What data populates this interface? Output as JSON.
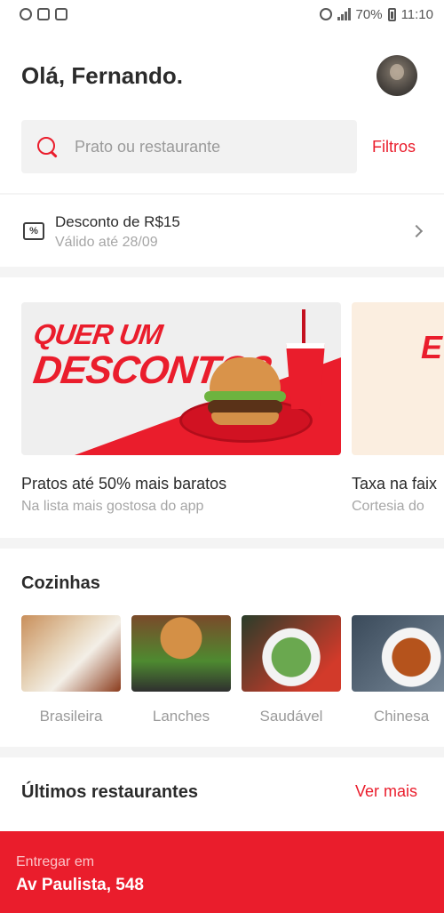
{
  "status_bar": {
    "battery": "70%",
    "time": "11:10",
    "left_icons": [
      "whatsapp-icon",
      "instagram-icon",
      "gallery-icon"
    ],
    "right_icons": [
      "mute-icon",
      "alarm-icon",
      "volte-icon",
      "wifi-icon",
      "nfc-icon",
      "signal-icon",
      "battery-icon"
    ]
  },
  "header": {
    "greeting": "Olá, Fernando.",
    "avatar_icon": "user-avatar"
  },
  "search": {
    "placeholder": "Prato ou restaurante",
    "filters_label": "Filtros",
    "icon": "search-icon"
  },
  "coupon": {
    "title": "Desconto de R$15",
    "subtitle": "Válido até 28/09",
    "icon_glyph": "%"
  },
  "banners": [
    {
      "headline_line1": "QUER UM",
      "headline_line2": "DESCONTO?",
      "title": "Pratos até 50% mais baratos",
      "subtitle": "Na lista mais gostosa do app"
    },
    {
      "headline_line1": "E",
      "title": "Taxa na faix",
      "subtitle": "Cortesia do"
    }
  ],
  "cuisines": {
    "title": "Cozinhas",
    "items": [
      {
        "label": "Brasileira"
      },
      {
        "label": "Lanches"
      },
      {
        "label": "Saudável"
      },
      {
        "label": "Chinesa"
      }
    ]
  },
  "recent": {
    "title": "Últimos restaurantes",
    "see_more_label": "Ver mais"
  },
  "delivery": {
    "label": "Entregar em",
    "address": "Av Paulista, 548"
  },
  "colors": {
    "brand_red": "#ea1d2c",
    "text_dark": "#2b2b2b",
    "text_muted": "#a6a6a6"
  }
}
